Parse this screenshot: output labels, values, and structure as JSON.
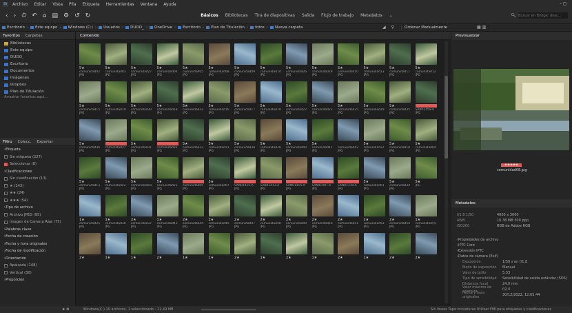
{
  "menu": [
    "Archivo",
    "Editar",
    "Vista",
    "Pila",
    "Etiqueta",
    "Herramientas",
    "Ventana",
    "Ayuda"
  ],
  "workspaces": [
    {
      "label": "Básicos",
      "active": true
    },
    {
      "label": "Bibliotecas",
      "active": false
    },
    {
      "label": "Tira de diapositivas",
      "active": false
    },
    {
      "label": "Salida",
      "active": false
    },
    {
      "label": "Flujo de trabajo",
      "active": false
    },
    {
      "label": "Metadatos",
      "active": false
    }
  ],
  "search_placeholder": "Buscar en Bridge: desc...",
  "path": [
    "Escritorio",
    "Este equipo",
    "Windows (C:)",
    "Usuarios",
    "DUOO_",
    "OneDrive",
    "Escritorio",
    "Plan de Titulación",
    "fotos",
    "Nueva carpeta"
  ],
  "sort_label": "Ordenar Manualmente",
  "left_tabs": [
    "Favoritos",
    "Carpetas"
  ],
  "favorites": [
    "Bibliotecas",
    "Este equipo",
    "DUOO_",
    "Escritorio",
    "Documentos",
    "Imágenes",
    "Dropbox",
    "Plan de Titulación"
  ],
  "favorites_hint": "Arrastrar favoritos aquí...",
  "filter_tabs": [
    "Filtro",
    "Colecc.",
    "Exportar"
  ],
  "filters": [
    {
      "label": "Etiqueta",
      "hd": true
    },
    {
      "label": "Sin etiqueta (227)",
      "cb": true
    },
    {
      "label": "Seleccionar (8)",
      "cb": true,
      "red": true
    },
    {
      "label": "Clasificaciones",
      "hd": true
    },
    {
      "label": "Sin clasificación (13)",
      "cb": true
    },
    {
      "label": "★ (143)",
      "cb": true
    },
    {
      "label": "★★ (24)",
      "cb": true
    },
    {
      "label": "★★★ (54)",
      "cb": true
    },
    {
      "label": "Tipo de archivo",
      "hd": true
    },
    {
      "label": "Archivo JPEG (95)",
      "cb": true
    },
    {
      "label": "Imagen de Camera Raw (75)",
      "cb": true
    },
    {
      "label": "Palabras clave",
      "hd": true
    },
    {
      "label": "Fecha de creación",
      "hd": true
    },
    {
      "label": "Fecha y hora originales",
      "hd": true
    },
    {
      "label": "Fecha de modificación",
      "hd": true
    },
    {
      "label": "Orientación",
      "hd": true
    },
    {
      "label": "Apaisada (148)",
      "cb": true
    },
    {
      "label": "Vertical (30)",
      "cb": true
    },
    {
      "label": "Proporción",
      "hd": true
    }
  ],
  "content_title": "Contenido",
  "rows": [
    {
      "stars": [
        "5★",
        "5★",
        "5★",
        "5★",
        "5★",
        "5★",
        "5★",
        "5★",
        "5★",
        "5★",
        "5★",
        "5★",
        "5★",
        "5★"
      ],
      "names": [
        "comunidad02",
        "comunidad03",
        "comunidad27",
        "comunidad04",
        "comunidad05",
        "comunidad08",
        "comunidad09",
        "comunidad14",
        "comunidad26",
        "comunidad28",
        "comunidad10",
        "comunidad13",
        "comunidad11",
        "comunidad12"
      ],
      "ext": "JPG"
    },
    {
      "stars": [
        "5★",
        "5★",
        "5★",
        "5★",
        "5★",
        "5★",
        "5★",
        "5★",
        "5★",
        "5★",
        "5★",
        "5★",
        "5★",
        ""
      ],
      "names": [
        "comunidad15",
        "comunidad19",
        "comunidad30",
        "comunidad18",
        "comunidad32",
        "comunidad16",
        "comunidad17",
        "comunidad19",
        "comunidad22",
        "comunidad23",
        "comunidad25",
        "comunidad29",
        "comunidad35",
        "SAN01459-R"
      ],
      "ext": "JPG"
    },
    {
      "stars": [
        "5★",
        "",
        "5★",
        "",
        "5★",
        "5★",
        "5★",
        "5★",
        "5★",
        "5★",
        "",
        "5★",
        "5★",
        "5★"
      ],
      "names": [
        "comunidad36",
        "comunidad37",
        "comunidad31",
        "comunidad32",
        "comunidad33",
        "comunidad21",
        "comunidad38",
        "comunidad39",
        "comunidad40",
        "comunidad41",
        "comunidad42",
        "comunidad37",
        "comunidad18",
        "comunidad04"
      ],
      "ext": "JPG"
    },
    {
      "stars": [
        "5★",
        "5★",
        "5★",
        "5★",
        "",
        "5★",
        "",
        "",
        "",
        "",
        "",
        "5★",
        "5★",
        "5★"
      ],
      "names": [
        "comunidad13",
        "comunidad42",
        "comunidad03",
        "comunidad23",
        "comunidad05",
        "comunidad07",
        "SAN01415-A",
        "SAN01413-A",
        "SAN01415-A",
        "SAN01407-A",
        "SAN01339-A",
        "comunidad01",
        "comunidad34",
        ""
      ],
      "ext": "JPG"
    },
    {
      "stars": [
        "1★",
        "1★",
        "2★",
        "1★",
        "2★",
        "2★",
        "2★",
        "2★",
        "2★",
        "2★",
        "2★",
        "2★",
        "2★",
        "1★"
      ],
      "names": [
        "comunidad25",
        "comunidad36",
        "comunidad37",
        "comunidad43",
        "comunidad44",
        "comunidad45",
        "comunidad47",
        "comunidad48",
        "comunidad49",
        "comunidad50",
        "comunidad51",
        "comunidad53",
        "comunidad54",
        "comunidad55"
      ],
      "ext": "JPG"
    },
    {
      "stars": [
        "2★",
        "1★",
        "1★",
        "2★",
        "1★",
        "1★",
        "2★",
        "1★",
        "2★",
        "1★",
        "2★",
        "1★",
        "2★",
        "2★"
      ],
      "names": [
        "",
        "",
        "",
        "",
        "",
        "",
        "",
        "",
        "",
        "",
        "",
        "",
        "",
        ""
      ],
      "ext": ""
    }
  ],
  "red_labels": [
    [
      1,
      13
    ],
    [
      2,
      1
    ],
    [
      2,
      3
    ],
    [
      3,
      4
    ],
    [
      3,
      6
    ],
    [
      3,
      7
    ],
    [
      3,
      8
    ],
    [
      3,
      9
    ],
    [
      3,
      10
    ]
  ],
  "preview_title": "Previsualizar",
  "preview_caption": "comunidad08.jpg",
  "metadata_title": "Metadatos",
  "meta_top": [
    {
      "k": "f/1.8   1/50",
      "v": "4000 x 3000"
    },
    {
      "k": "AWB",
      "v": "10.38 MB     300 ppp"
    },
    {
      "k": "ISO200",
      "v": "RGB de Adobe  RGB"
    }
  ],
  "meta_sections": [
    "Propiedades de archivo",
    "IPTC Core",
    "Extensión IPTC",
    "Datos de cámara (Exif)"
  ],
  "exif": [
    {
      "k": "Exposición",
      "v": "1/50 s en f/1.8"
    },
    {
      "k": "Modo de exposición",
      "v": "Manual"
    },
    {
      "k": "Valor de brillo",
      "v": "5.33"
    },
    {
      "k": "Tipo de sensibilidad",
      "v": "Sensibilidad de salida estándar (SOS)"
    },
    {
      "k": "Distancia focal",
      "v": "24,0 mm"
    },
    {
      "k": "Valor máximo de apertura",
      "v": "f/2.0"
    },
    {
      "k": "Fecha y hora originales",
      "v": "30/12/2022, 12:05:44"
    }
  ],
  "status": "Windows(C:) 10 archivos, 1 seleccionado - 11,49 MB",
  "status_right": "Sin líneas   Tapa miniaturas   Utilizar FMI para etiquetas y clasificaciones"
}
